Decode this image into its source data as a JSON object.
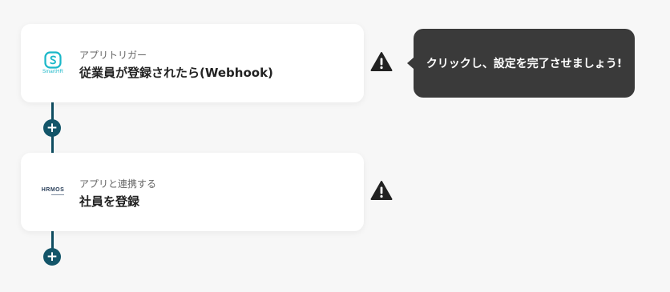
{
  "flow": {
    "steps": [
      {
        "app": "SmartHR",
        "subtitle": "アプリトリガー",
        "title": "従業員が登録されたら(Webhook)"
      },
      {
        "app": "HRMOS",
        "subtitle": "アプリと連携する",
        "title": "社員を登録"
      }
    ],
    "add_label": "+"
  },
  "tooltip": {
    "text": "クリックし、設定を完了させましょう!"
  },
  "logos": {
    "smarthr_caption": "SmartHR",
    "hrmos_caption": "HRMOS"
  },
  "colors": {
    "connector": "#0f4d61",
    "add_button": "#135569",
    "smarthr_brand": "#19b7c8",
    "tooltip_bg": "#3a3a3a",
    "warning": "#222222"
  },
  "icons": {
    "warning": "warning-icon",
    "add": "plus-icon"
  }
}
